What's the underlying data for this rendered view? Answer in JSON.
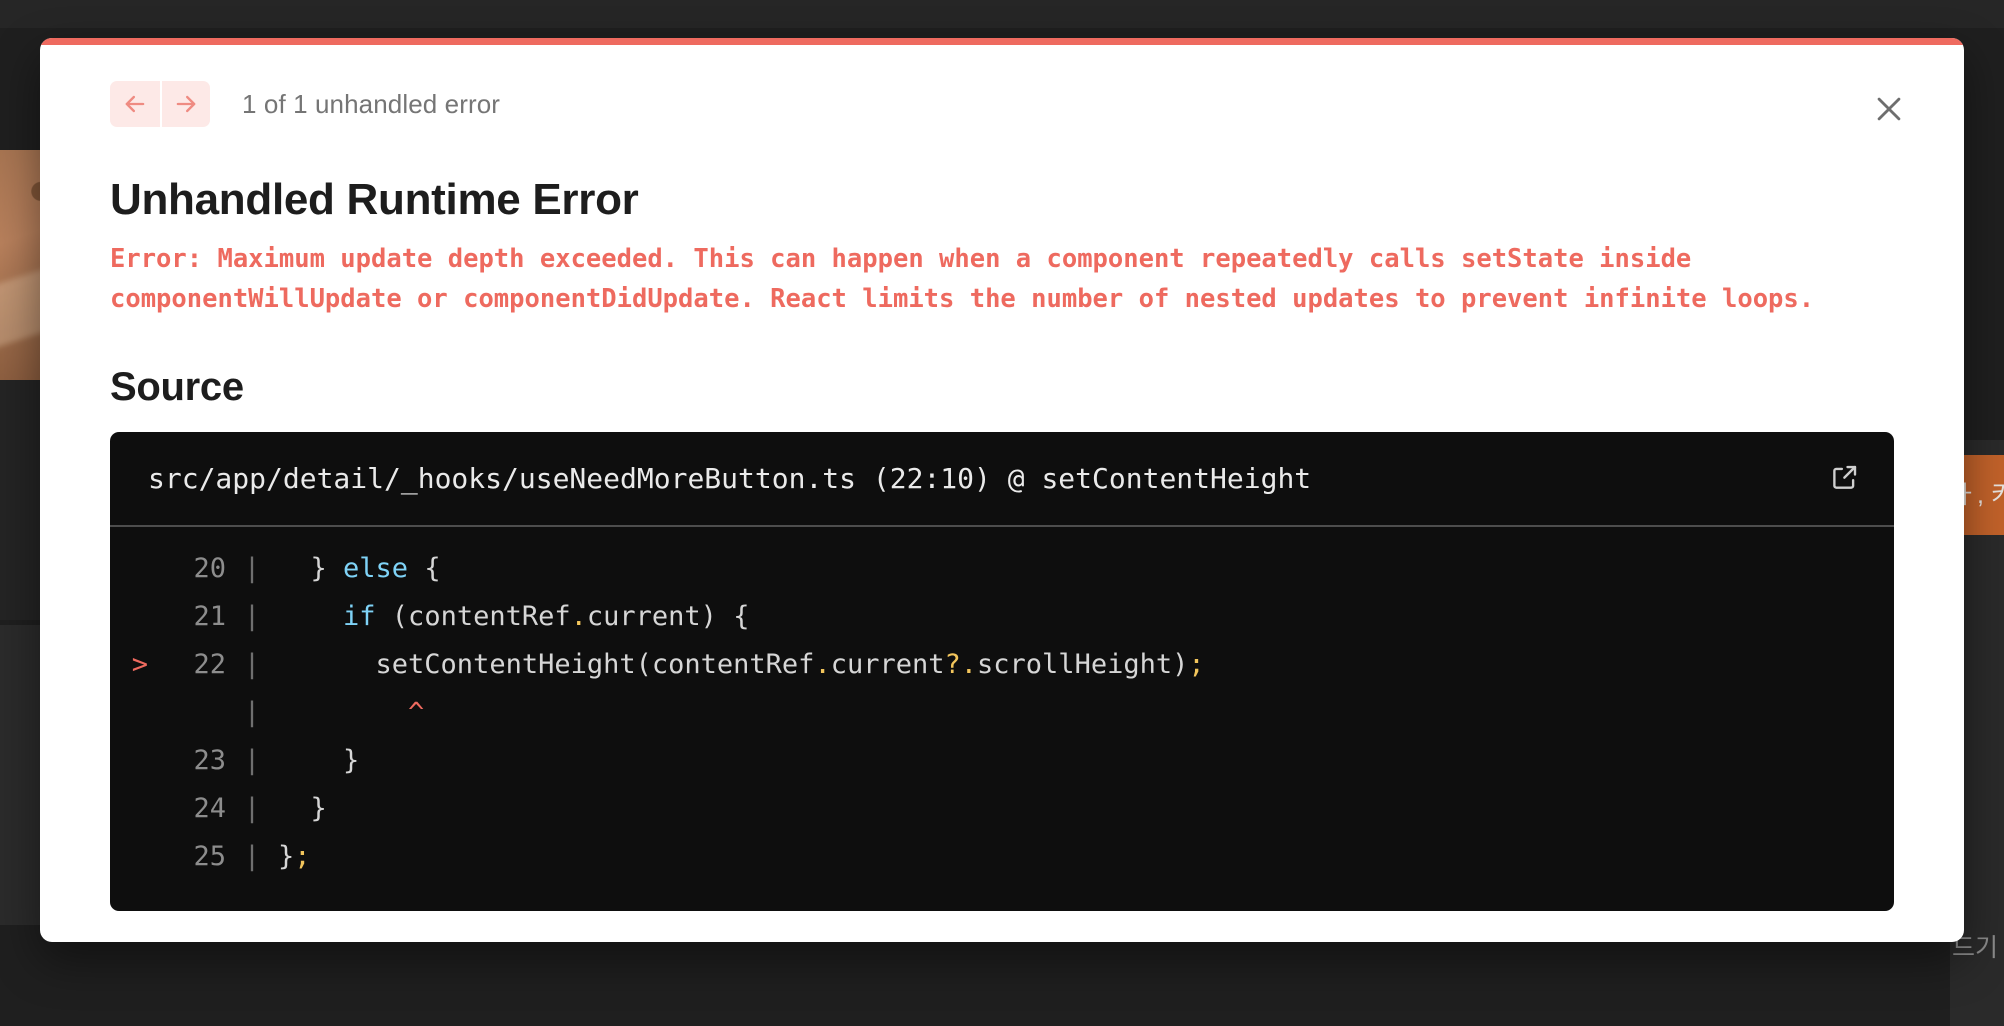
{
  "background": {
    "tooltip_text": "ㅏ, 키",
    "korean_label": "드기"
  },
  "overlay": {
    "accent_color": "#ee6a5f",
    "header": {
      "prev_label": "←",
      "next_label": "→",
      "error_count": "1 of 1 unhandled error",
      "close_label": "✕"
    },
    "runtime_title": "Unhandled Runtime Error",
    "error_message": "Error: Maximum update depth exceeded. This can happen when a component repeatedly calls setState inside componentWillUpdate or componentDidUpdate. React limits the number of nested updates to prevent infinite loops.",
    "source_title": "Source",
    "code": {
      "file_path": "src/app/detail/_hooks/useNeedMoreButton.ts (22:10) @ setContentHeight",
      "open_in_editor_label": "open-in-editor",
      "lines": [
        {
          "marker": "",
          "number": "20",
          "segments": [
            {
              "text": "  } ",
              "type": "plain"
            },
            {
              "text": "else",
              "type": "keyword"
            },
            {
              "text": " {",
              "type": "plain"
            }
          ]
        },
        {
          "marker": "",
          "number": "21",
          "segments": [
            {
              "text": "    ",
              "type": "plain"
            },
            {
              "text": "if",
              "type": "keyword"
            },
            {
              "text": " (contentRef",
              "type": "plain"
            },
            {
              "text": ".",
              "type": "punct"
            },
            {
              "text": "current) {",
              "type": "plain"
            }
          ]
        },
        {
          "marker": ">",
          "number": "22",
          "segments": [
            {
              "text": "      setContentHeight(contentRef",
              "type": "plain"
            },
            {
              "text": ".",
              "type": "punct"
            },
            {
              "text": "current",
              "type": "plain"
            },
            {
              "text": "?",
              "type": "punct"
            },
            {
              "text": ".",
              "type": "punct"
            },
            {
              "text": "scrollHeight)",
              "type": "plain"
            },
            {
              "text": ";",
              "type": "punct"
            }
          ]
        },
        {
          "marker": "",
          "number": "",
          "segments": [
            {
              "text": "        ",
              "type": "plain"
            },
            {
              "text": "^",
              "type": "caret"
            }
          ]
        },
        {
          "marker": "",
          "number": "23",
          "segments": [
            {
              "text": "    }",
              "type": "plain"
            }
          ]
        },
        {
          "marker": "",
          "number": "24",
          "segments": [
            {
              "text": "  }",
              "type": "plain"
            }
          ]
        },
        {
          "marker": "",
          "number": "25",
          "segments": [
            {
              "text": "}",
              "type": "plain"
            },
            {
              "text": ";",
              "type": "punct"
            }
          ]
        }
      ]
    }
  }
}
